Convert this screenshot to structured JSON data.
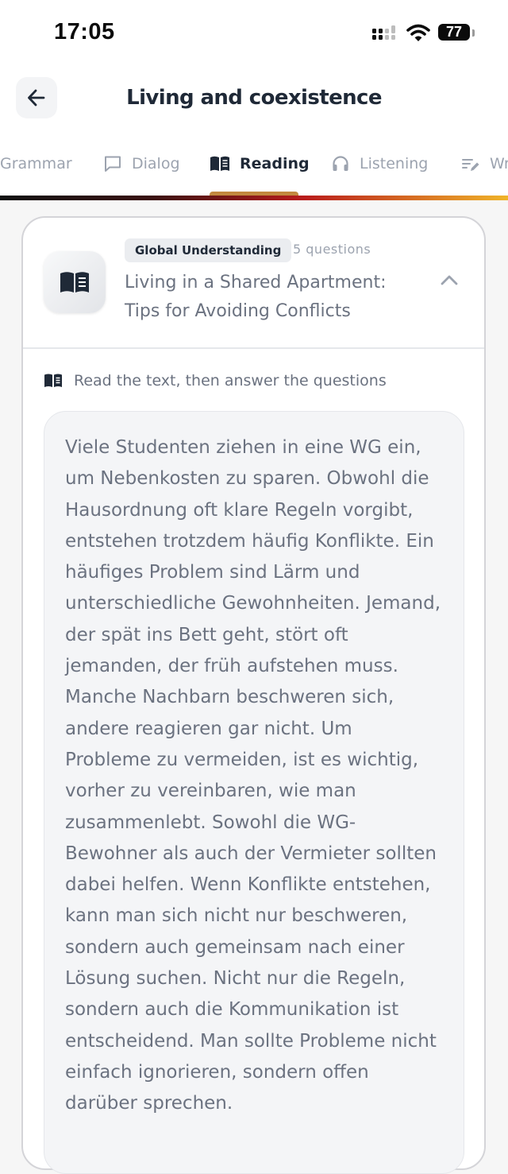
{
  "status_bar": {
    "time": "17:05",
    "battery": "77",
    "icons": [
      "signal-icon",
      "wifi-icon",
      "battery-icon"
    ]
  },
  "header": {
    "title": "Living and coexistence",
    "back_icon": "arrow-left-icon"
  },
  "tabs": [
    {
      "label": "Grammar",
      "icon": "grammar-icon",
      "active": false
    },
    {
      "label": "Dialog",
      "icon": "chat-bubble-icon",
      "active": false
    },
    {
      "label": "Reading",
      "icon": "book-icon",
      "active": true
    },
    {
      "label": "Listening",
      "icon": "headphones-icon",
      "active": false
    },
    {
      "label": "Wr",
      "icon": "pencil-lines-icon",
      "active": false
    }
  ],
  "card": {
    "badge": "Global Understanding",
    "question_count": "5 questions",
    "title": "Living in a Shared Apartment: Tips for Avoiding Conflicts",
    "instruction": "Read the text, then answer the questions",
    "text": "Viele Studenten ziehen in eine WG ein, um Nebenkosten zu sparen. Obwohl die Hausordnung oft klare Regeln vorgibt, entstehen trotzdem häufig Konflikte. Ein häufiges Problem sind Lärm und unterschiedliche Gewohnheiten. Jemand, der spät ins Bett geht, stört oft jemanden, der früh aufstehen muss. Manche Nachbarn beschweren sich, andere reagieren gar nicht. Um Probleme zu vermeiden, ist es wichtig, vorher zu vereinbaren, wie man zusammenlebt. Sowohl die WG-Bewohner als auch der Vermieter sollten dabei helfen. Wenn Konflikte entstehen, kann man sich nicht nur beschweren, sondern auch gemeinsam nach einer Lösung suchen. Nicht nur die Regeln, sondern auch die Kommunikation ist entscheidend. Man sollte Probleme nicht einfach ignorieren, sondern offen darüber sprechen."
  },
  "colors": {
    "accent": "#c2893f",
    "title": "#1f2937",
    "muted": "#9ca3af",
    "gradient": [
      "#111111",
      "#b91c1c",
      "#f0b429"
    ]
  }
}
